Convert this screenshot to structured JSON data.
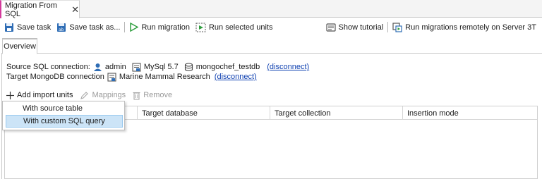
{
  "document_tab": {
    "title": "Migration From SQL",
    "close_glyph": "✕"
  },
  "toolbar": {
    "save_task": "Save task",
    "save_task_as": "Save task as...",
    "run_migration": "Run migration",
    "run_selected_units": "Run selected units",
    "show_tutorial": "Show tutorial",
    "run_remotely": "Run migrations remotely on Server 3T"
  },
  "sub_tabs": {
    "overview": "Overview"
  },
  "connections": {
    "source_label": "Source SQL connection:",
    "source_user": "admin",
    "source_server": "MySql 5.7",
    "source_database": "mongochef_testdb",
    "source_disconnect": "(disconnect)",
    "target_label": "Target MongoDB connection",
    "target_name": "Marine Mammal Research",
    "target_disconnect": "(disconnect)"
  },
  "actions": {
    "add_import_units": "Add import units",
    "mappings": "Mappings",
    "remove": "Remove"
  },
  "table": {
    "columns": [
      "Target database",
      "Target collection",
      "Insertion mode"
    ]
  },
  "add_menu": {
    "items": [
      "With source table",
      "With custom SQL query"
    ],
    "highlighted_index": 1
  },
  "colors": {
    "tab_accent": "#d43b9c",
    "link": "#0d3fb0",
    "menu_highlight": "#cce4f7",
    "run_green": "#2e9e3e"
  }
}
